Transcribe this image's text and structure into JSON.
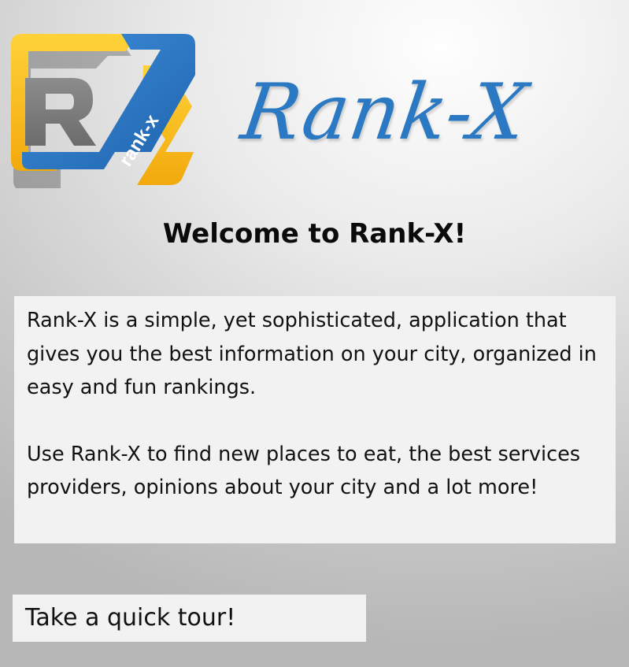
{
  "brand": {
    "icon_letter": "R",
    "icon_text": "rank-x",
    "name": "Rank-X",
    "colors": {
      "blue": "#2b79c2",
      "yellow": "#fbbd1a",
      "gray": "#7a7a7a"
    }
  },
  "welcome": {
    "title": "Welcome to Rank-X!"
  },
  "intro": {
    "paragraph_1": "Rank-X is a simple, yet sophisticated, application that gives you the best information on your city, organized in easy and fun rankings.",
    "paragraph_2": "Use Rank-X to find new places to eat, the best services providers, opinions about your city and a lot more!"
  },
  "actions": {
    "tour_label": "Take a quick tour!"
  }
}
